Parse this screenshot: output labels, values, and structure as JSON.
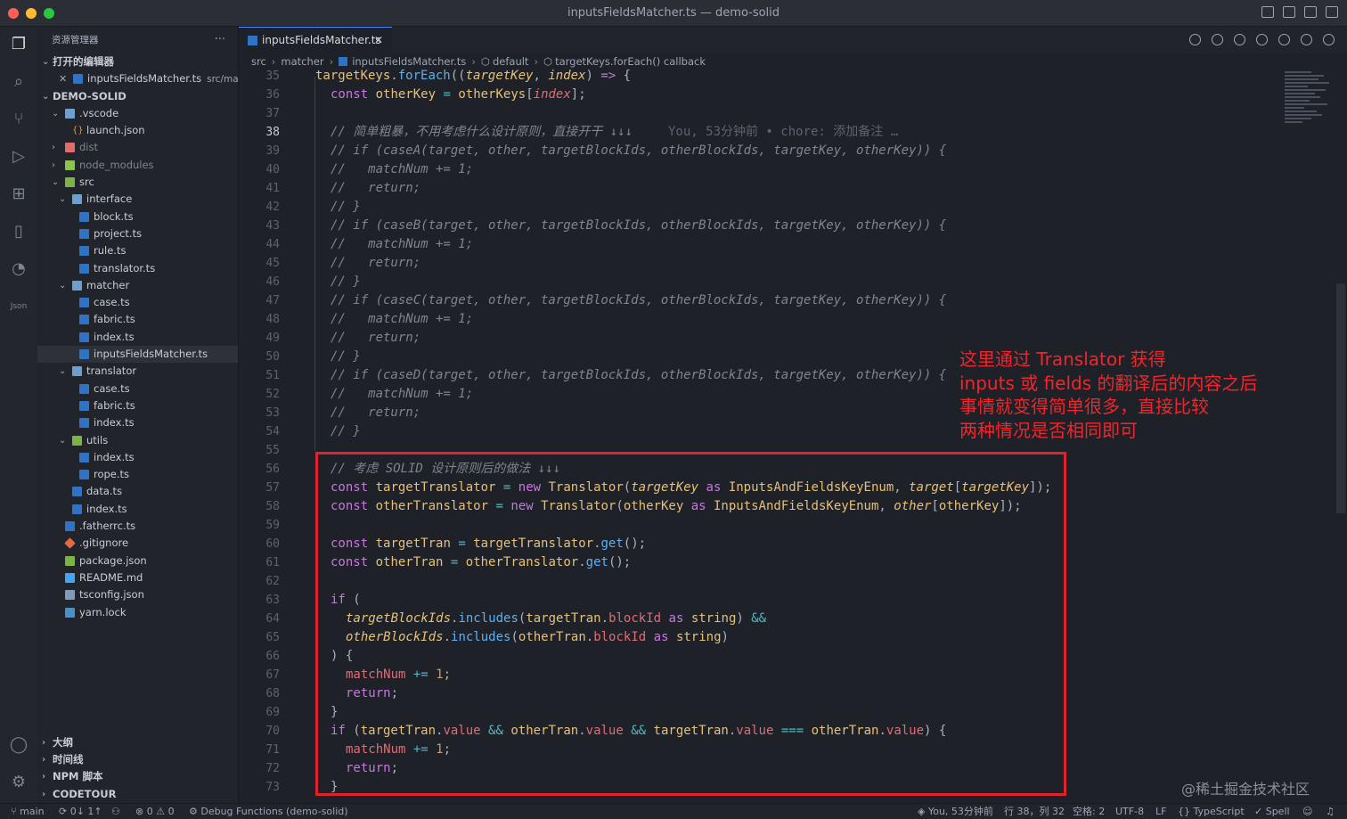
{
  "window": {
    "title": "inputsFieldsMatcher.ts — demo-solid"
  },
  "sidebar": {
    "title": "资源管理器",
    "more": "···",
    "open_editors": {
      "label": "打开的编辑器",
      "file": "inputsFieldsMatcher.ts",
      "path": "src/ma..."
    },
    "project": "DEMO-SOLID",
    "tree": [
      {
        "label": ".vscode",
        "chev": "⌄",
        "icon": "folder"
      },
      {
        "label": "launch.json",
        "chev": "",
        "icon": "json"
      },
      {
        "label": "dist",
        "chev": "›",
        "icon": "folder-dist",
        "dim": true
      },
      {
        "label": "node_modules",
        "chev": "›",
        "icon": "folder-nm",
        "dim": true
      },
      {
        "label": "src",
        "chev": "⌄",
        "icon": "folder-src"
      },
      {
        "label": "interface",
        "chev": "⌄",
        "icon": "folder"
      },
      {
        "label": "block.ts",
        "chev": "",
        "icon": "ts"
      },
      {
        "label": "project.ts",
        "chev": "",
        "icon": "ts"
      },
      {
        "label": "rule.ts",
        "chev": "",
        "icon": "ts"
      },
      {
        "label": "translator.ts",
        "chev": "",
        "icon": "ts"
      },
      {
        "label": "matcher",
        "chev": "⌄",
        "icon": "folder"
      },
      {
        "label": "case.ts",
        "chev": "",
        "icon": "ts"
      },
      {
        "label": "fabric.ts",
        "chev": "",
        "icon": "ts"
      },
      {
        "label": "index.ts",
        "chev": "",
        "icon": "ts"
      },
      {
        "label": "inputsFieldsMatcher.ts",
        "chev": "",
        "icon": "ts",
        "selected": true
      },
      {
        "label": "translator",
        "chev": "⌄",
        "icon": "folder"
      },
      {
        "label": "case.ts",
        "chev": "",
        "icon": "ts"
      },
      {
        "label": "fabric.ts",
        "chev": "",
        "icon": "ts"
      },
      {
        "label": "index.ts",
        "chev": "",
        "icon": "ts"
      },
      {
        "label": "utils",
        "chev": "⌄",
        "icon": "folder-src"
      },
      {
        "label": "index.ts",
        "chev": "",
        "icon": "ts"
      },
      {
        "label": "rope.ts",
        "chev": "",
        "icon": "ts"
      },
      {
        "label": "data.ts",
        "chev": "",
        "icon": "ts"
      },
      {
        "label": "index.ts",
        "chev": "",
        "icon": "ts"
      },
      {
        "label": ".fatherrc.ts",
        "chev": "",
        "icon": "ts"
      },
      {
        "label": ".gitignore",
        "chev": "",
        "icon": "git"
      },
      {
        "label": "package.json",
        "chev": "",
        "icon": "npm"
      },
      {
        "label": "README.md",
        "chev": "",
        "icon": "info"
      },
      {
        "label": "tsconfig.json",
        "chev": "",
        "icon": "lines"
      },
      {
        "label": "yarn.lock",
        "chev": "",
        "icon": "yarn"
      }
    ],
    "bottom": [
      "大纲",
      "时间线",
      "NPM 脚本",
      "CODETOUR"
    ]
  },
  "tab": {
    "label": "inputsFieldsMatcher.ts",
    "close": "✕"
  },
  "breadcrumb": [
    "src",
    "matcher",
    "inputsFieldsMatcher.ts",
    "default",
    "targetKeys.forEach() callback"
  ],
  "code": {
    "first_line": 35,
    "current_line": 38,
    "blame": "You, 53分钟前 • chore: 添加备注 …"
  },
  "annotation": [
    "这里通过 Translator 获得",
    "inputs 或 fields 的翻译后的内容之后",
    "事情就变得简单很多，直接比较",
    "两种情况是否相同即可"
  ],
  "status": {
    "branch": "main",
    "sync": "0↓ 1↑",
    "problems": "⊗ 0 ⚠ 0",
    "debug": "Debug Functions (demo-solid)",
    "blame": "You, 53分钟前",
    "position": "行 38，列 32",
    "spaces": "空格: 2",
    "encoding": "UTF-8",
    "eol": "LF",
    "lang": "{} TypeScript",
    "spell": "✓ Spell"
  },
  "watermark": "@稀土掘金技术社区",
  "colors": {
    "accent": "#528bff",
    "annotation": "#e0222c"
  }
}
